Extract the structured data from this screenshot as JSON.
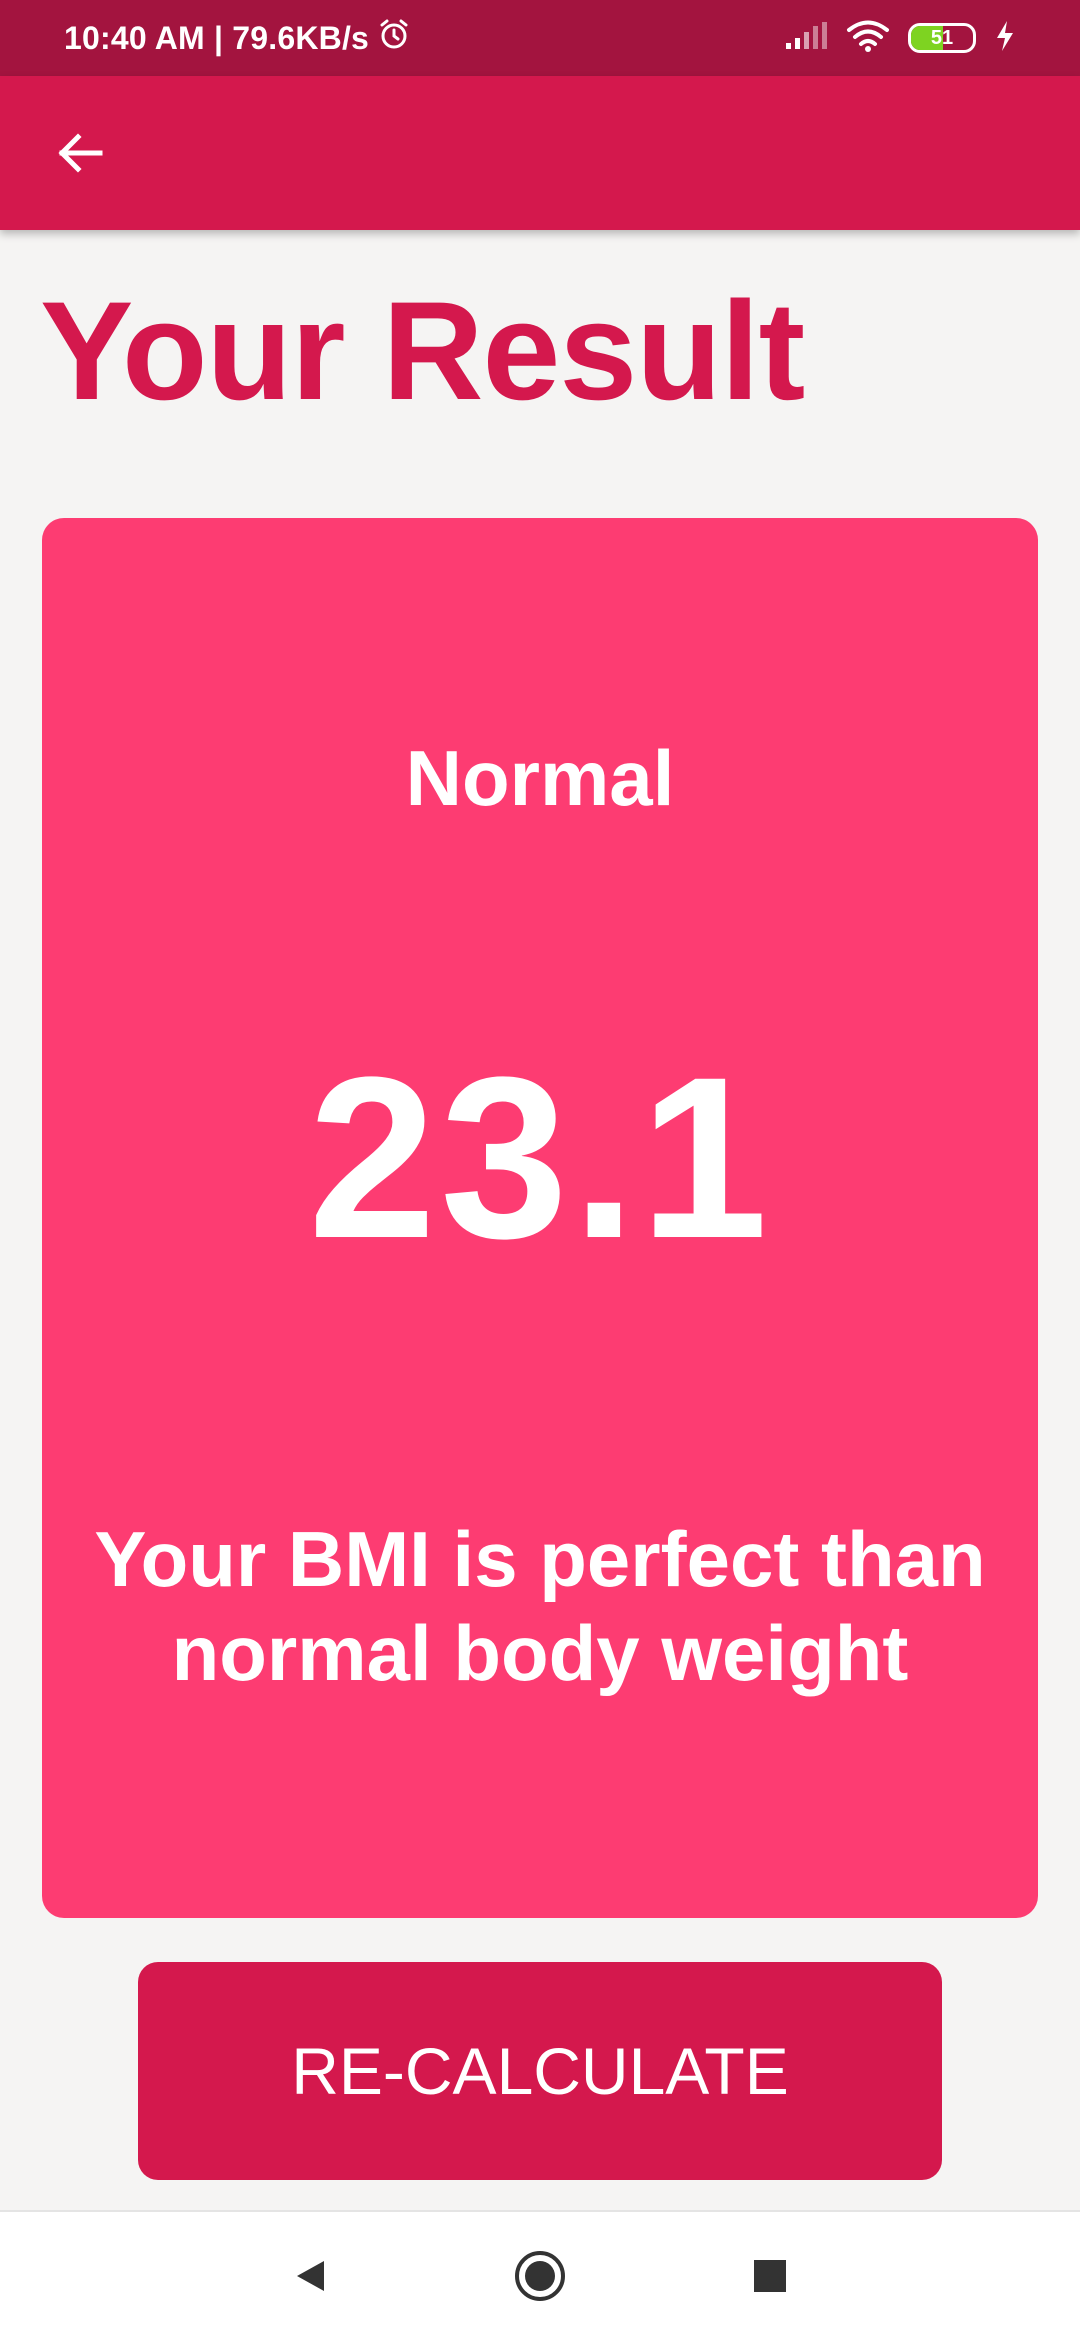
{
  "status_bar": {
    "time_speed": "10:40 AM | 79.6KB/s",
    "battery_level": "51",
    "battery_fraction": 0.51,
    "icons": [
      "alarm-icon",
      "signal-icon",
      "wifi-icon",
      "battery-icon",
      "charging-icon"
    ]
  },
  "app_bar": {
    "back_icon": "arrow-left-icon"
  },
  "page": {
    "title": "Your Result"
  },
  "result": {
    "status": "Normal",
    "bmi": "23.1",
    "message": "Your BMI is perfect than normal body weight"
  },
  "actions": {
    "recalculate_label": "RE-CALCULATE"
  },
  "nav": {
    "icons": [
      "back-triangle-icon",
      "home-circle-icon",
      "recents-square-icon"
    ]
  },
  "colors": {
    "status_bar": "#A3143F",
    "primary": "#D4184D",
    "card": "#FD3C72",
    "background": "#F5F4F3"
  }
}
